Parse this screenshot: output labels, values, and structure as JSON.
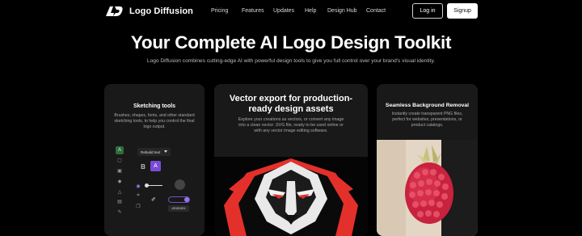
{
  "brand": {
    "name": "Logo Diffusion"
  },
  "nav": {
    "items": [
      "Pricing",
      "Features",
      "Updates",
      "Help",
      "Design Hub",
      "Contact"
    ],
    "login_label": "Log in",
    "signup_label": "Signup"
  },
  "hero": {
    "title": "Your Complete AI Logo Design Toolkit",
    "subtitle": "Logo Diffusion combines cutting-edge AI with powerful design tools to give you full control over your brand's visual identity."
  },
  "cards": [
    {
      "title": "Sketching tools",
      "description": "Brushes, shapes, fonts, and other standard sketching tools, to help you control the final logo output."
    },
    {
      "title": "Vector export for production-ready design assets",
      "description": "Explore your creations as vectors, or convert any image into a clean vector .SVG file, ready to be used online or with any vector image editing software."
    },
    {
      "title": "Seamless Background Removal",
      "description": "Instantly create transparent PNG files, perfect for websites, presentations, or product catalogs."
    }
  ],
  "sketch_panel": {
    "dropdown_value": "Rebuild text",
    "hex_value": "#E6E6E6"
  },
  "colors": {
    "background": "#000000",
    "card": "#191919",
    "accent_purple": "#7a4bd6",
    "lion_red": "#e4302a"
  },
  "icons": [
    "logo-mark-icon",
    "text-tool-icon",
    "shape-tool-icon",
    "pen-tool-icon",
    "fill-tool-icon",
    "image-tool-icon",
    "brush-tool-icon",
    "crop-tool-icon",
    "eyedropper-icon"
  ]
}
